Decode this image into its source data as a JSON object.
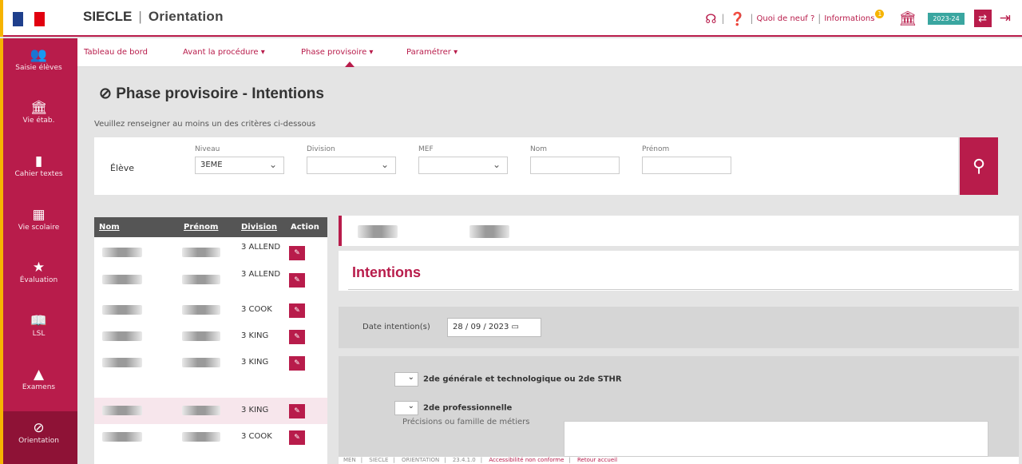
{
  "header": {
    "app": "SIECLE",
    "module": "Orientation",
    "links": [
      "Quoi de neuf ?",
      "Informations"
    ],
    "badge": "1",
    "year": "2023-24",
    "colors": {
      "primary": "#b81c4b",
      "accent": "#f6b400",
      "teal": "#3aa6a0"
    }
  },
  "sidebar": {
    "items": [
      {
        "label": "Saisie élèves",
        "icon": "students-icon"
      },
      {
        "label": "Vie étab.",
        "icon": "institution-icon"
      },
      {
        "label": "Cahier textes",
        "icon": "book-icon"
      },
      {
        "label": "Vie scolaire",
        "icon": "calendar-icon"
      },
      {
        "label": "Évaluation",
        "icon": "star-icon"
      },
      {
        "label": "LSL",
        "icon": "open-book-icon"
      },
      {
        "label": "Examens",
        "icon": "exam-icon"
      },
      {
        "label": "Orientation",
        "icon": "compass-icon"
      }
    ]
  },
  "menu": {
    "items": [
      "Tableau de bord",
      "Avant la procédure ▾",
      "Phase provisoire ▾",
      "Paramétrer ▾"
    ]
  },
  "page": {
    "title": "Phase provisoire - Intentions",
    "subtitle": "Veuillez renseigner au moins un des critères ci-dessous"
  },
  "search": {
    "eleve_label": "Élève",
    "fields": [
      {
        "label": "Niveau",
        "value": "3EME"
      },
      {
        "label": "Division",
        "value": ""
      },
      {
        "label": "MEF",
        "value": ""
      },
      {
        "label": "Nom",
        "value": ""
      },
      {
        "label": "Prénom",
        "value": ""
      }
    ]
  },
  "table": {
    "headers": [
      "Nom",
      "Prénom",
      "Division",
      "Action"
    ],
    "rows": [
      {
        "division": "3 ALLEND"
      },
      {
        "division": "3 ALLEND"
      },
      {
        "division": "3 COOK"
      },
      {
        "division": "3 KING"
      },
      {
        "division": "3 KING"
      },
      {
        "division": "3 KING"
      },
      {
        "division": "3 COOK"
      }
    ]
  },
  "intentions": {
    "heading": "Intentions",
    "date_label": "Date intention(s)",
    "date_value": "28 / 09 / 2023",
    "choices": [
      "2de générale et technologique ou 2de STHR",
      "2de professionnelle"
    ],
    "motifs_label": "Précisions ou famille de métiers"
  },
  "footer": {
    "items": [
      "MEN",
      "SIECLE",
      "ORIENTATION",
      "23.4.1.0"
    ],
    "links": [
      "Accessibilité non conforme",
      "Retour accueil"
    ]
  }
}
